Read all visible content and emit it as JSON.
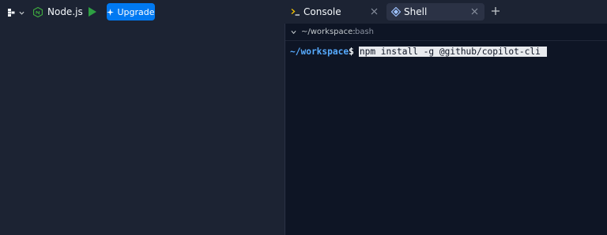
{
  "toolbar": {
    "project_name": "Node.js",
    "upgrade_label": "Upgrade",
    "accent_color": "#0079f2",
    "run_color": "#2ea043"
  },
  "tabs": [
    {
      "label": "Console",
      "icon": "terminal-prompt-icon",
      "active": false
    },
    {
      "label": "Shell",
      "icon": "shell-icon",
      "active": true
    }
  ],
  "shell": {
    "path": "~/workspace:",
    "shell_name": "bash",
    "prompt_dir": "~/workspace",
    "prompt_symbol": "$",
    "command": "npm install -g @github/copilot-cli "
  }
}
